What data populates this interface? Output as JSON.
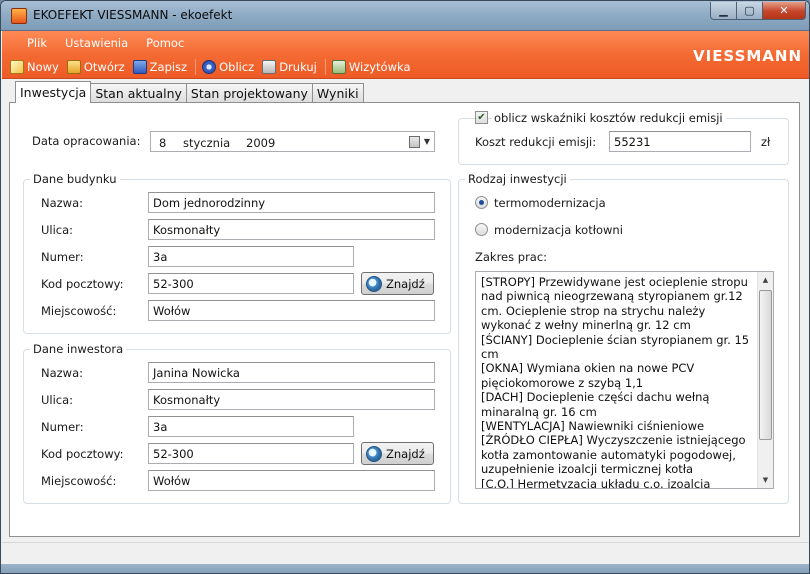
{
  "window": {
    "title": "EKOEFEKT VIESSMANN - ekoefekt"
  },
  "menu": [
    {
      "label": "Plik"
    },
    {
      "label": "Ustawienia"
    },
    {
      "label": "Pomoc"
    }
  ],
  "toolbar": [
    {
      "label": "Nowy",
      "icon": "new-document-icon"
    },
    {
      "label": "Otwórz",
      "icon": "open-folder-icon"
    },
    {
      "label": "Zapisz",
      "icon": "save-disk-icon"
    },
    {
      "label": "Oblicz",
      "icon": "gear-icon"
    },
    {
      "label": "Drukuj",
      "icon": "printer-icon"
    },
    {
      "label": "Wizytówka",
      "icon": "business-card-icon"
    }
  ],
  "logo": "VIESSMANN",
  "tabs": [
    {
      "label": "Inwestycja",
      "active": true
    },
    {
      "label": "Stan aktualny"
    },
    {
      "label": "Stan projektowany"
    },
    {
      "label": "Wyniki"
    }
  ],
  "date": {
    "label": "Data opracowania:",
    "day": "8",
    "month": "stycznia",
    "year": "2009"
  },
  "emisja": {
    "checkbox_label": "oblicz wskaźniki kosztów redukcji emisji",
    "checked": true,
    "cost_label": "Koszt redukcji emisji:",
    "cost_value": "55231",
    "unit": "zł"
  },
  "budynek": {
    "title": "Dane budynku",
    "nazwa_label": "Nazwa:",
    "nazwa": "Dom jednorodzinny",
    "ulica_label": "Ulica:",
    "ulica": "Kosmonałty",
    "numer_label": "Numer:",
    "numer": "3a",
    "kod_label": "Kod pocztowy:",
    "kod": "52-300",
    "miejsc_label": "Miejscowość:",
    "miejsc": "Wołów",
    "find_label": "Znajdź"
  },
  "inwestor": {
    "title": "Dane inwestora",
    "nazwa_label": "Nazwa:",
    "nazwa": "Janina Nowicka",
    "ulica_label": "Ulica:",
    "ulica": "Kosmonałty",
    "numer_label": "Numer:",
    "numer": "3a",
    "kod_label": "Kod pocztowy:",
    "kod": "52-300",
    "miejsc_label": "Miejscowość:",
    "miejsc": "Wołów",
    "find_label": "Znajdź"
  },
  "rodzaj": {
    "title": "Rodzaj inwestycji",
    "option1": "termomodernizacja",
    "option2": "modernizacja kotłowni",
    "selected": "termomodernizacja",
    "zakres_label": "Zakres prac:",
    "zakres_text": "[STROPY] Przewidywane jest ocieplenie stropu nad piwnicą nieogrzewaną styropianem gr.12 cm. Ocieplenie strop na strychu należy wykonać z wełny minerlną gr. 12 cm\n[ŚCIANY] Docieplenie ścian styropianem gr. 15 cm\n[OKNA] Wymiana okien na nowe PCV pięciokomorowe z szybą 1,1\n[DACH] Docieplenie części dachu wełną minaralną gr. 16 cm\n[WENTYLACJA] Nawiewniki ciśnieniowe\n[ŹRÓDŁO CIEPŁA] Wyczyszczenie istniejącego kotła zamontowanie automatyki pogodowej, uzupełnienie izoalcji termicznej kotła\n[C.O.] Hermetyzacja układu c.o. izoalcja termiczna rur w piwnicy, montaż zaworów"
  }
}
